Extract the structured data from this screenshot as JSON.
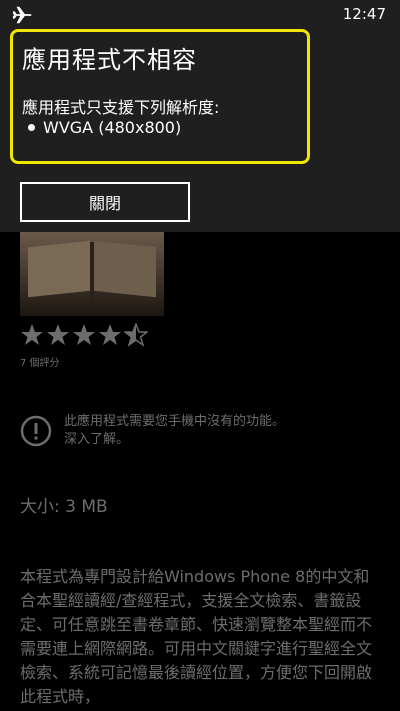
{
  "status_bar": {
    "clock": "12:47",
    "airplane_icon": "airplane-icon"
  },
  "dialog": {
    "title": "應用程式不相容",
    "message": "應用程式只支援下列解析度:",
    "resolutions": [
      "WVGA (480x800)"
    ],
    "close_label": "關閉",
    "highlight_color": "#f0e600"
  },
  "app_page": {
    "rating": {
      "value": 4.5,
      "max": 5,
      "count_label": "7 個評分"
    },
    "warning": {
      "icon": "exclamation-circle-icon",
      "line1": "此應用程式需要您手機中沒有的功能。",
      "line2": "深入了解。"
    },
    "size": "大小: 3 MB",
    "description": "本程式為專門設計給Windows Phone 8的中文和合本聖經讀經/查經程式，支援全文檢索、書籤設定、可任意跳至書卷章節、快速瀏覽整本聖經而不需要連上網際網路。可用中文關鍵字進行聖經全文檢索、系統可記憶最後讀經位置，方便您下回開啟此程式時，"
  }
}
